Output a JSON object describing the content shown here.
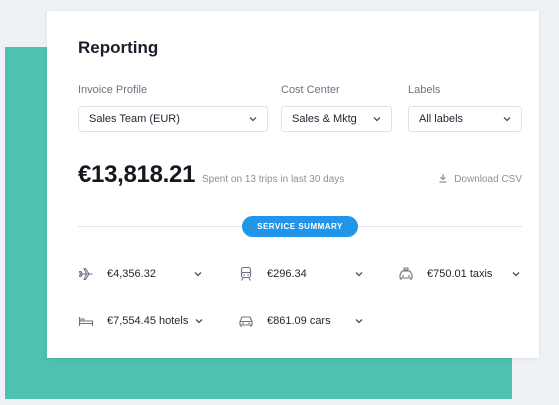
{
  "reporting": {
    "title": "Reporting",
    "filters": {
      "invoice_profile": {
        "label": "Invoice Profile",
        "value": "Sales Team (EUR)"
      },
      "cost_center": {
        "label": "Cost Center",
        "value": "Sales & Mktg"
      },
      "labels": {
        "label": "Labels",
        "value": "All labels"
      }
    },
    "total": {
      "amount": "€13,818.21",
      "description": "Spent on 13 trips in last 30 days"
    },
    "download_label": "Download CSV",
    "service_summary_label": "SERVICE SUMMARY",
    "services": {
      "flights": {
        "value": "€4,356.32",
        "icon": "airplane-icon"
      },
      "trains": {
        "value": "€296.34",
        "icon": "train-icon"
      },
      "taxis": {
        "value": "€750.01 taxis",
        "icon": "taxi-icon"
      },
      "hotels": {
        "value": "€7,554.45 hotels",
        "icon": "bed-icon"
      },
      "cars": {
        "value": "€861.09 cars",
        "icon": "car-icon"
      }
    }
  },
  "colors": {
    "teal": "#4fc1b0",
    "accent_blue": "#2196e8",
    "page_bg": "#eef1f5"
  }
}
